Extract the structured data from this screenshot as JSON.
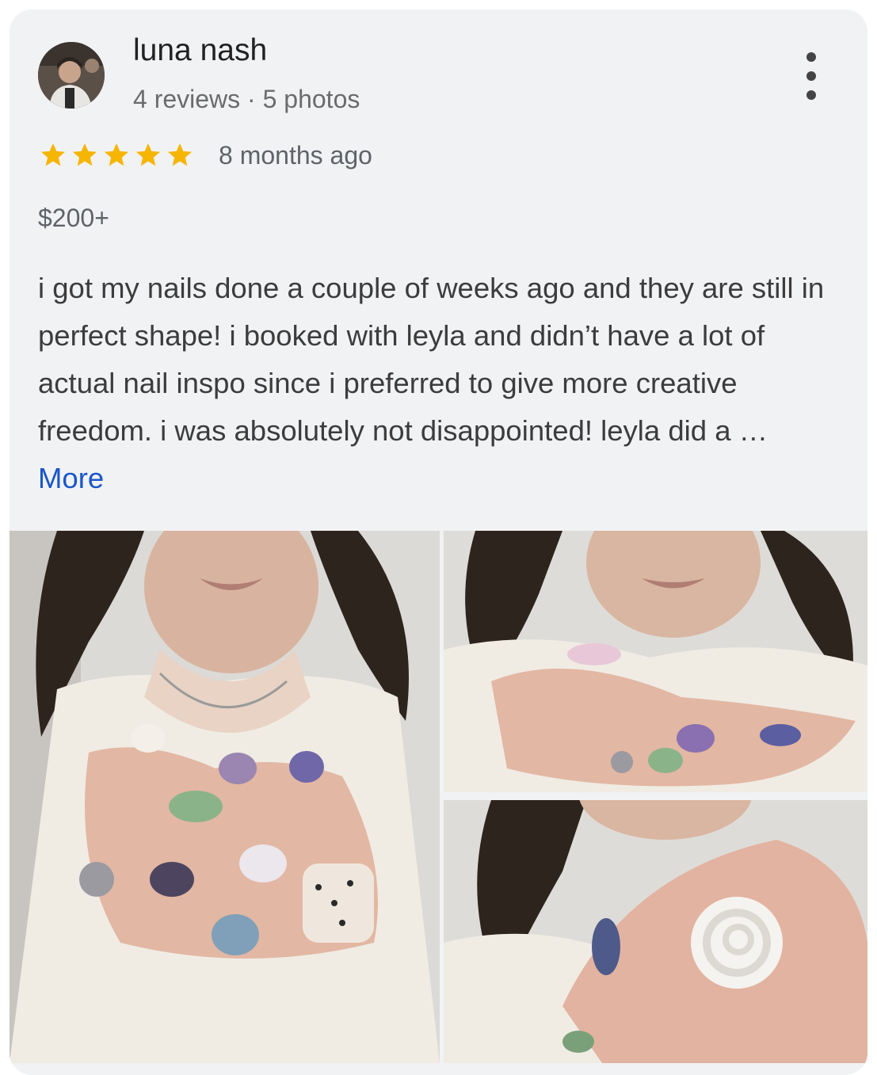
{
  "reviewer": {
    "name": "luna nash",
    "stats": "4 reviews · 5 photos",
    "avatar_icon": "profile-photo"
  },
  "menu": {
    "icon": "more-vertical-icon"
  },
  "rating": {
    "stars": 5,
    "max": 5,
    "star_color": "#f5b500",
    "time_ago": "8 months ago"
  },
  "price": "$200+",
  "review": {
    "text": "i got my nails done a couple of weeks ago and they are still in perfect shape! i booked with leyla and didn’t have a lot of actual nail inspo since i preferred to give more creative freedom. i was absolutely not disappointed! leyla did a …",
    "more_label": "More",
    "link_color": "#1a56c8"
  }
}
